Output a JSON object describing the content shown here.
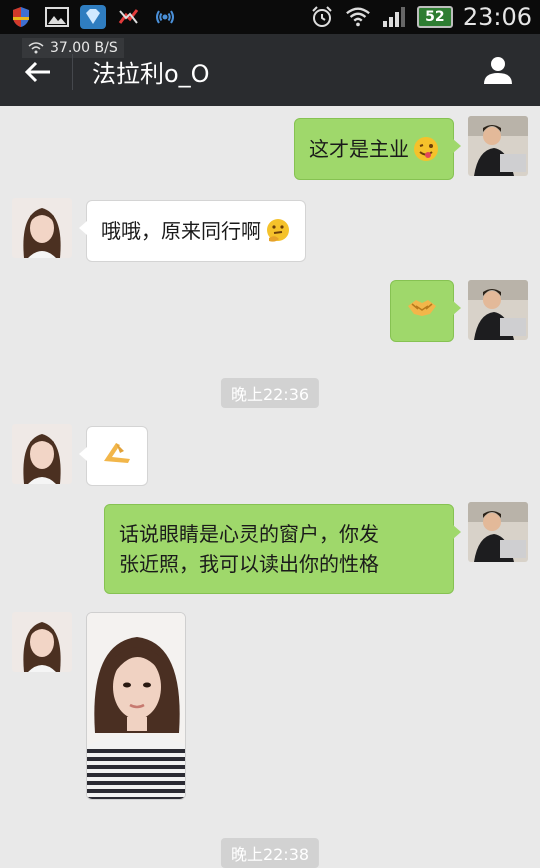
{
  "status_bar": {
    "battery": "52",
    "time": "23:06"
  },
  "header": {
    "net_speed": "37.00 B/S",
    "contact_name": "法拉利o_O"
  },
  "messages": [
    {
      "side": "out",
      "text": "这才是主业",
      "emoji": "winking-tongue-emoji"
    },
    {
      "side": "in",
      "text": "哦哦，原来同行啊",
      "emoji": "thinking-emoji"
    },
    {
      "side": "out",
      "text": "",
      "emoji": "handshake-emoji"
    },
    {
      "side": "time",
      "text": "晚上22:36"
    },
    {
      "side": "in",
      "text": "",
      "emoji": "pinched-hand-emoji"
    },
    {
      "side": "out",
      "text_line1": "话说眼睛是心灵的窗户，你发",
      "text_line2": "张近照，我可以读出你的性格"
    },
    {
      "side": "in",
      "image": "selfie-photo"
    },
    {
      "side": "time",
      "text": "晚上22:38"
    }
  ],
  "colors": {
    "status_bg": "#0b0b0b",
    "header_bg": "#2a2c2f",
    "chat_bg": "#e9e9e9",
    "bubble_out": "#9fd86b",
    "bubble_in": "#ffffff",
    "timestamp_bg": "#d2d2d2",
    "battery": "#2e7d32"
  }
}
